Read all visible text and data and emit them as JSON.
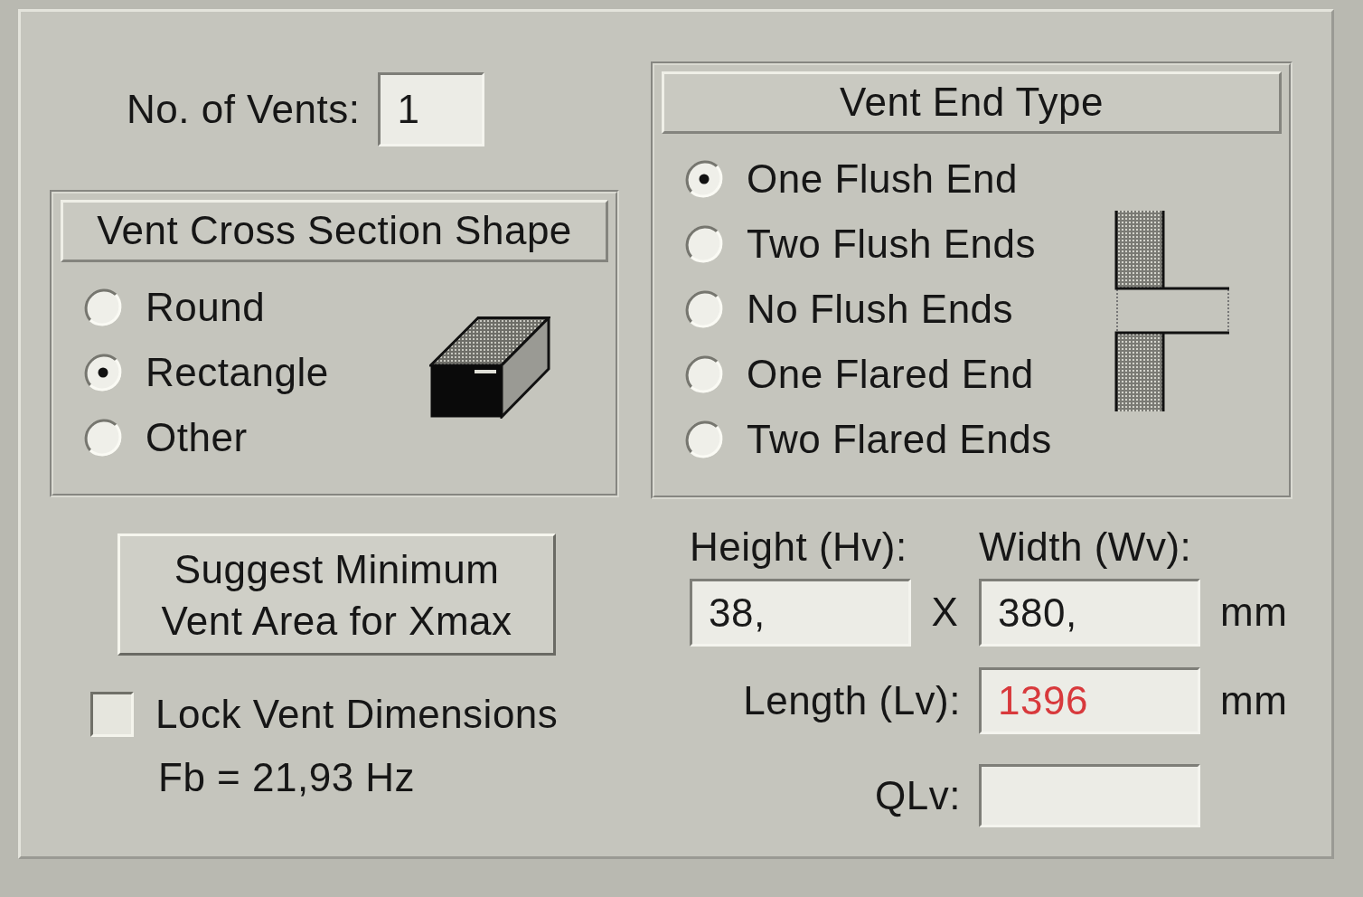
{
  "vents": {
    "label": "No. of Vents:",
    "value": "1"
  },
  "cross_section": {
    "title": "Vent Cross Section Shape",
    "options": [
      {
        "label": "Round",
        "selected": false
      },
      {
        "label": "Rectangle",
        "selected": true
      },
      {
        "label": "Other",
        "selected": false
      }
    ]
  },
  "vent_end_type": {
    "title": "Vent End Type",
    "options": [
      {
        "label": "One Flush End",
        "selected": true
      },
      {
        "label": "Two Flush Ends",
        "selected": false
      },
      {
        "label": "No Flush Ends",
        "selected": false
      },
      {
        "label": "One Flared End",
        "selected": false
      },
      {
        "label": "Two Flared Ends",
        "selected": false
      }
    ]
  },
  "suggest_button": {
    "lines": [
      "Suggest Minimum",
      "Vent Area for Xmax"
    ]
  },
  "lock_dimensions": {
    "label": "Lock Vent Dimensions",
    "checked": false
  },
  "fb_readout": "Fb = 21,93 Hz",
  "dimensions": {
    "height": {
      "label": "Height (Hv):",
      "value": "38,",
      "alert": false
    },
    "separator": "X",
    "width": {
      "label": "Width (Wv):",
      "value": "380,",
      "unit": "mm",
      "alert": false
    },
    "length": {
      "label": "Length (Lv):",
      "value": "1396",
      "unit": "mm",
      "alert": true
    },
    "qlv": {
      "label": "QLv:"
    }
  }
}
